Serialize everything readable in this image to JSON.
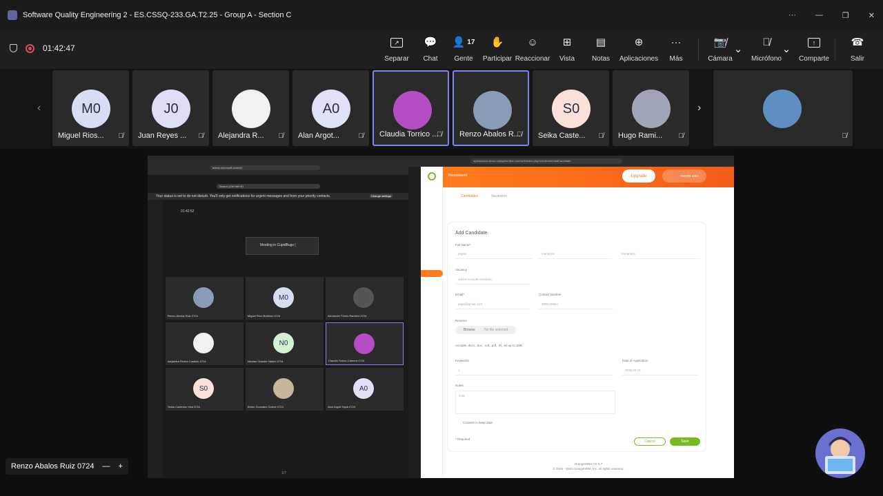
{
  "window": {
    "title": "Software Quality Engineering 2 - ES.CSSQ-233.GA.T2.25 - Group A - Section C"
  },
  "window_controls": [
    "···",
    "—",
    "❐",
    "✕"
  ],
  "meeting": {
    "timer": "01:42:47"
  },
  "toolbar": {
    "buttons": [
      {
        "label": "Separar"
      },
      {
        "label": "Chat"
      },
      {
        "label": "Gente",
        "count": "17"
      },
      {
        "label": "Participar"
      },
      {
        "label": "Reaccionar"
      },
      {
        "label": "Vista"
      },
      {
        "label": "Notas"
      },
      {
        "label": "Aplicaciones"
      },
      {
        "label": "Más"
      },
      {
        "label": "Cámara"
      },
      {
        "label": "Micrófono"
      },
      {
        "label": "Comparte"
      },
      {
        "label": "Salir"
      }
    ]
  },
  "participants": [
    {
      "name": "Miguel Rios...",
      "initials": "M0",
      "color": "#d9dcf5"
    },
    {
      "name": "Juan Reyes ...",
      "initials": "J0",
      "color": "#dcdff6"
    },
    {
      "name": "Alejandra R...",
      "initials": "",
      "color": "#f1f1f1"
    },
    {
      "name": "Alan Argot...",
      "initials": "A0",
      "color": "#dfe1f6"
    },
    {
      "name": "Claudia Torrico ...",
      "initials": "",
      "color": "#b44dc4"
    },
    {
      "name": "Renzo Abalos R...",
      "initials": "",
      "color": "#8a9bb8"
    },
    {
      "name": "Seika Caste...",
      "initials": "S0",
      "color": "#fde0da"
    },
    {
      "name": "Hugo Rami...",
      "initials": "",
      "color": "#9fa5b6"
    },
    {
      "name": "",
      "initials": "",
      "color": "#5f8fc0"
    }
  ],
  "shared_screen": {
    "teams_url": "teams.microsoft.com/v2/",
    "search_placeholder": "Search (Ctrl+Alt+E)",
    "notice": "Your status is set to do not disturb. You'll only get notifications for urgent messages and from your priority contacts.",
    "notice_action": "Change settings",
    "mini_timer": "01:42:52",
    "pip_title": "Meeting in CupidBugs |",
    "mini_participants": [
      {
        "name": "Renzo Abalos Ruiz 0724",
        "initials": "",
        "color": "#8a9bb8"
      },
      {
        "name": "Miguel Rios Martinez 0724",
        "initials": "M0",
        "color": "#d9dcf5"
      },
      {
        "name": "Alexander Flores Ramirez 0724",
        "initials": "",
        "color": "#555"
      },
      {
        "name": "Alejandra Rivera Castedo 0724",
        "initials": "",
        "color": "#f1f1f1"
      },
      {
        "name": "Nicolas Grandia Valdes 0724",
        "initials": "N0",
        "color": "#d4f1d4"
      },
      {
        "name": "Claudia Torrico Cabrera 0724",
        "initials": "",
        "color": "#b44dc4"
      },
      {
        "name": "Seika Castedon Irina 0724",
        "initials": "S0",
        "color": "#fde0da"
      },
      {
        "name": "Belen Gonzalez Galvez 0724",
        "initials": "",
        "color": "#c8b59a"
      },
      {
        "name": "Alan Argoti Tapia 0724",
        "initials": "A0",
        "color": "#dfe1f6"
      }
    ],
    "mini_page": "1/7",
    "ohrm_url": "opensource-demo.orangehrmlive.com/web/index.php/recruitment/addCandidate",
    "ohrm": {
      "page_title": "Recruitment",
      "upgrade": "Upgrade",
      "user": "manda user",
      "tabs": [
        "Candidates",
        "Vacancies"
      ],
      "form_title": "Add Candidate",
      "full_name_label": "Full Name*",
      "first_name": "pepito",
      "middle_name": "mendoza",
      "last_name": "fernandez",
      "vacancy_label": "Vacancy",
      "vacancy_value": "Junior Account Assistant",
      "email_label": "Email*",
      "email_value": "pepe@gmail.com",
      "contact_label": "Contact Number",
      "contact_value": "30RC20964",
      "resume_label": "Resume",
      "browse": "Browse",
      "no_file": "No file selected",
      "accepts": "Accepts .docx, .doc, .odt, .pdf, .rtf, .txt up to 1MB",
      "keywords_label": "Keywords",
      "keywords_value": "1",
      "date_label": "Date of Application",
      "date_value": "2025-03-11",
      "notes_label": "Notes",
      "notes_value": "hola",
      "consent": "Consent to keep data",
      "required": "* Required",
      "cancel": "Cancel",
      "save": "Save",
      "footer1": "OrangeHRM OS 5.7",
      "footer2": "© 2005 - 2025 OrangeHRM, Inc. All rights reserved."
    }
  },
  "presenter": {
    "name": "Renzo Abalos Ruiz 0724"
  }
}
